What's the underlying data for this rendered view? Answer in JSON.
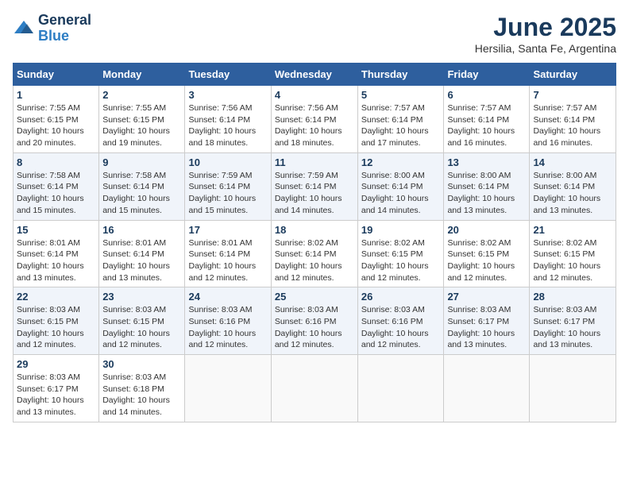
{
  "logo": {
    "line1": "General",
    "line2": "Blue"
  },
  "title": "June 2025",
  "subtitle": "Hersilia, Santa Fe, Argentina",
  "days_of_week": [
    "Sunday",
    "Monday",
    "Tuesday",
    "Wednesday",
    "Thursday",
    "Friday",
    "Saturday"
  ],
  "weeks": [
    [
      {
        "day": "1",
        "sunrise": "7:55 AM",
        "sunset": "6:15 PM",
        "daylight": "10 hours and 20 minutes."
      },
      {
        "day": "2",
        "sunrise": "7:55 AM",
        "sunset": "6:15 PM",
        "daylight": "10 hours and 19 minutes."
      },
      {
        "day": "3",
        "sunrise": "7:56 AM",
        "sunset": "6:14 PM",
        "daylight": "10 hours and 18 minutes."
      },
      {
        "day": "4",
        "sunrise": "7:56 AM",
        "sunset": "6:14 PM",
        "daylight": "10 hours and 18 minutes."
      },
      {
        "day": "5",
        "sunrise": "7:57 AM",
        "sunset": "6:14 PM",
        "daylight": "10 hours and 17 minutes."
      },
      {
        "day": "6",
        "sunrise": "7:57 AM",
        "sunset": "6:14 PM",
        "daylight": "10 hours and 16 minutes."
      },
      {
        "day": "7",
        "sunrise": "7:57 AM",
        "sunset": "6:14 PM",
        "daylight": "10 hours and 16 minutes."
      }
    ],
    [
      {
        "day": "8",
        "sunrise": "7:58 AM",
        "sunset": "6:14 PM",
        "daylight": "10 hours and 15 minutes."
      },
      {
        "day": "9",
        "sunrise": "7:58 AM",
        "sunset": "6:14 PM",
        "daylight": "10 hours and 15 minutes."
      },
      {
        "day": "10",
        "sunrise": "7:59 AM",
        "sunset": "6:14 PM",
        "daylight": "10 hours and 15 minutes."
      },
      {
        "day": "11",
        "sunrise": "7:59 AM",
        "sunset": "6:14 PM",
        "daylight": "10 hours and 14 minutes."
      },
      {
        "day": "12",
        "sunrise": "8:00 AM",
        "sunset": "6:14 PM",
        "daylight": "10 hours and 14 minutes."
      },
      {
        "day": "13",
        "sunrise": "8:00 AM",
        "sunset": "6:14 PM",
        "daylight": "10 hours and 13 minutes."
      },
      {
        "day": "14",
        "sunrise": "8:00 AM",
        "sunset": "6:14 PM",
        "daylight": "10 hours and 13 minutes."
      }
    ],
    [
      {
        "day": "15",
        "sunrise": "8:01 AM",
        "sunset": "6:14 PM",
        "daylight": "10 hours and 13 minutes."
      },
      {
        "day": "16",
        "sunrise": "8:01 AM",
        "sunset": "6:14 PM",
        "daylight": "10 hours and 13 minutes."
      },
      {
        "day": "17",
        "sunrise": "8:01 AM",
        "sunset": "6:14 PM",
        "daylight": "10 hours and 12 minutes."
      },
      {
        "day": "18",
        "sunrise": "8:02 AM",
        "sunset": "6:14 PM",
        "daylight": "10 hours and 12 minutes."
      },
      {
        "day": "19",
        "sunrise": "8:02 AM",
        "sunset": "6:15 PM",
        "daylight": "10 hours and 12 minutes."
      },
      {
        "day": "20",
        "sunrise": "8:02 AM",
        "sunset": "6:15 PM",
        "daylight": "10 hours and 12 minutes."
      },
      {
        "day": "21",
        "sunrise": "8:02 AM",
        "sunset": "6:15 PM",
        "daylight": "10 hours and 12 minutes."
      }
    ],
    [
      {
        "day": "22",
        "sunrise": "8:03 AM",
        "sunset": "6:15 PM",
        "daylight": "10 hours and 12 minutes."
      },
      {
        "day": "23",
        "sunrise": "8:03 AM",
        "sunset": "6:15 PM",
        "daylight": "10 hours and 12 minutes."
      },
      {
        "day": "24",
        "sunrise": "8:03 AM",
        "sunset": "6:16 PM",
        "daylight": "10 hours and 12 minutes."
      },
      {
        "day": "25",
        "sunrise": "8:03 AM",
        "sunset": "6:16 PM",
        "daylight": "10 hours and 12 minutes."
      },
      {
        "day": "26",
        "sunrise": "8:03 AM",
        "sunset": "6:16 PM",
        "daylight": "10 hours and 12 minutes."
      },
      {
        "day": "27",
        "sunrise": "8:03 AM",
        "sunset": "6:17 PM",
        "daylight": "10 hours and 13 minutes."
      },
      {
        "day": "28",
        "sunrise": "8:03 AM",
        "sunset": "6:17 PM",
        "daylight": "10 hours and 13 minutes."
      }
    ],
    [
      {
        "day": "29",
        "sunrise": "8:03 AM",
        "sunset": "6:17 PM",
        "daylight": "10 hours and 13 minutes."
      },
      {
        "day": "30",
        "sunrise": "8:03 AM",
        "sunset": "6:18 PM",
        "daylight": "10 hours and 14 minutes."
      },
      null,
      null,
      null,
      null,
      null
    ]
  ]
}
